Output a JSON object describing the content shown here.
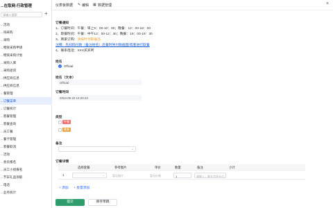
{
  "app": {
    "title": "...在取网-行政管理"
  },
  "sidebar": {
    "search_placeholder": "请输入搜索",
    "items": [
      {
        "label": "...活动"
      },
      {
        "label": "...询采购"
      },
      {
        "label": "...采购"
      },
      {
        "label": "...物资采购申请"
      },
      {
        "label": "...物资采购计划"
      },
      {
        "label": "...采购入库"
      },
      {
        "label": "...采购退货"
      },
      {
        "label": "...供应商信息"
      },
      {
        "label": "...供应商信息"
      },
      {
        "label": "...餐管理"
      },
      {
        "label": "...订餐菜单"
      },
      {
        "label": "...订餐统计"
      },
      {
        "label": "...客餐管理"
      },
      {
        "label": "...客餐查询"
      },
      {
        "label": "...员工餐"
      },
      {
        "label": "...餐卡管理"
      },
      {
        "label": "...客餐取消"
      },
      {
        "label": "...活动"
      },
      {
        "label": "...会员报名"
      },
      {
        "label": "...员工小组报名"
      },
      {
        "label": "...节日礼品领取"
      },
      {
        "label": "...电话"
      },
      {
        "label": "...业务统计"
      }
    ]
  },
  "topbar": {
    "tab_main": "仪表板数据",
    "tab_edit": "编辑",
    "tab_data": "数据管理"
  },
  "notice": {
    "label": "订餐通知",
    "lines": [
      "1、订餐时间：午餐：早上9：00-10：00；晚餐：12：00-18：00",
      "2、取餐时间：午餐：中午12：00-12：30；晚餐：19：00-19：30",
      "3、商家订购：",
      "4、联系电话：XXX买买呵"
    ],
    "line3_highlight": "请按时领取餐品",
    "link_text": "注释：先扫码付款（备注姓名）后餐时凭付款截图/或者进行取餐"
  },
  "form": {
    "name_label": "姓名",
    "name_option": "Official",
    "name_text_label": "姓名（文本）",
    "name_text_value": "Official",
    "order_time_label": "订餐时间",
    "order_time_value": "2024-05-22 14:20:43",
    "meal_type_label": "类型",
    "meal_options": [
      "午餐",
      "晚餐"
    ],
    "meal_tag_colors": [
      "#f56c6c",
      "#e6a23c"
    ],
    "remarks_label": "备注",
    "details_label": "订餐详情",
    "table_headers": [
      "选择套餐",
      "参考图片",
      "单价",
      "数量",
      "备注",
      "小计"
    ],
    "row_index": "1",
    "row_image_placeholder": "暂无图片",
    "row_price_placeholder": "暂无价格",
    "row_qty": "1",
    "row_note_placeholder": "请输入，最长字段长达...",
    "add_row": "+ 添加",
    "add_batch": "+ 批量添加",
    "submit": "提交",
    "save_draft": "保存草稿"
  },
  "colors": {
    "accent": "#2f6bff",
    "primary_button": "#2e9d6b"
  }
}
